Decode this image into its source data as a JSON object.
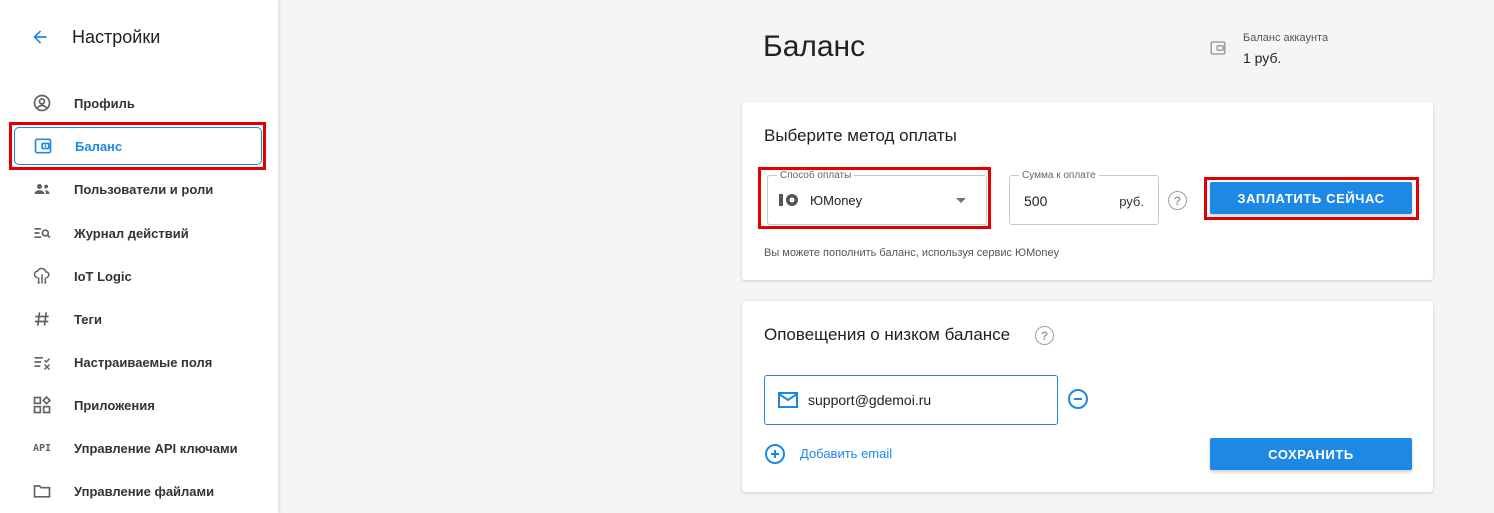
{
  "sidebar": {
    "title": "Настройки",
    "items": [
      {
        "label": "Профиль",
        "icon": "account-circle-icon"
      },
      {
        "label": "Баланс",
        "icon": "wallet-icon",
        "active": true
      },
      {
        "label": "Пользователи и роли",
        "icon": "users-icon"
      },
      {
        "label": "Журнал действий",
        "icon": "list-search-icon"
      },
      {
        "label": "IoT Logic",
        "icon": "cloud-tree-icon"
      },
      {
        "label": "Теги",
        "icon": "hashtag-icon"
      },
      {
        "label": "Настраиваемые поля",
        "icon": "list-check-icon"
      },
      {
        "label": "Приложения",
        "icon": "apps-icon"
      },
      {
        "label": "Управление API ключами",
        "icon": "api-icon"
      },
      {
        "label": "Управление файлами",
        "icon": "folder-icon"
      }
    ],
    "api_icon_text": "API"
  },
  "main": {
    "title": "Баланс",
    "account_balance": {
      "caption": "Баланс аккаунта",
      "value": "1 руб."
    },
    "payment_card": {
      "title": "Выберите метод оплаты",
      "method_label": "Способ оплаты",
      "method_value": "ЮMoney",
      "amount_label": "Сумма к оплате",
      "amount_value": "500",
      "amount_unit": "руб.",
      "help_symbol": "?",
      "pay_button": "ЗАПЛАТИТЬ СЕЙЧАС",
      "hint": "Вы можете пополнить баланс, используя сервис ЮMoney"
    },
    "alerts_card": {
      "title": "Оповещения о низком балансе",
      "help_symbol": "?",
      "email": "support@gdemoi.ru",
      "add_email": "Добавить email",
      "save_button": "СОХРАНИТЬ"
    }
  },
  "colors": {
    "accent": "#1e88e5",
    "highlight": "#e00000"
  }
}
